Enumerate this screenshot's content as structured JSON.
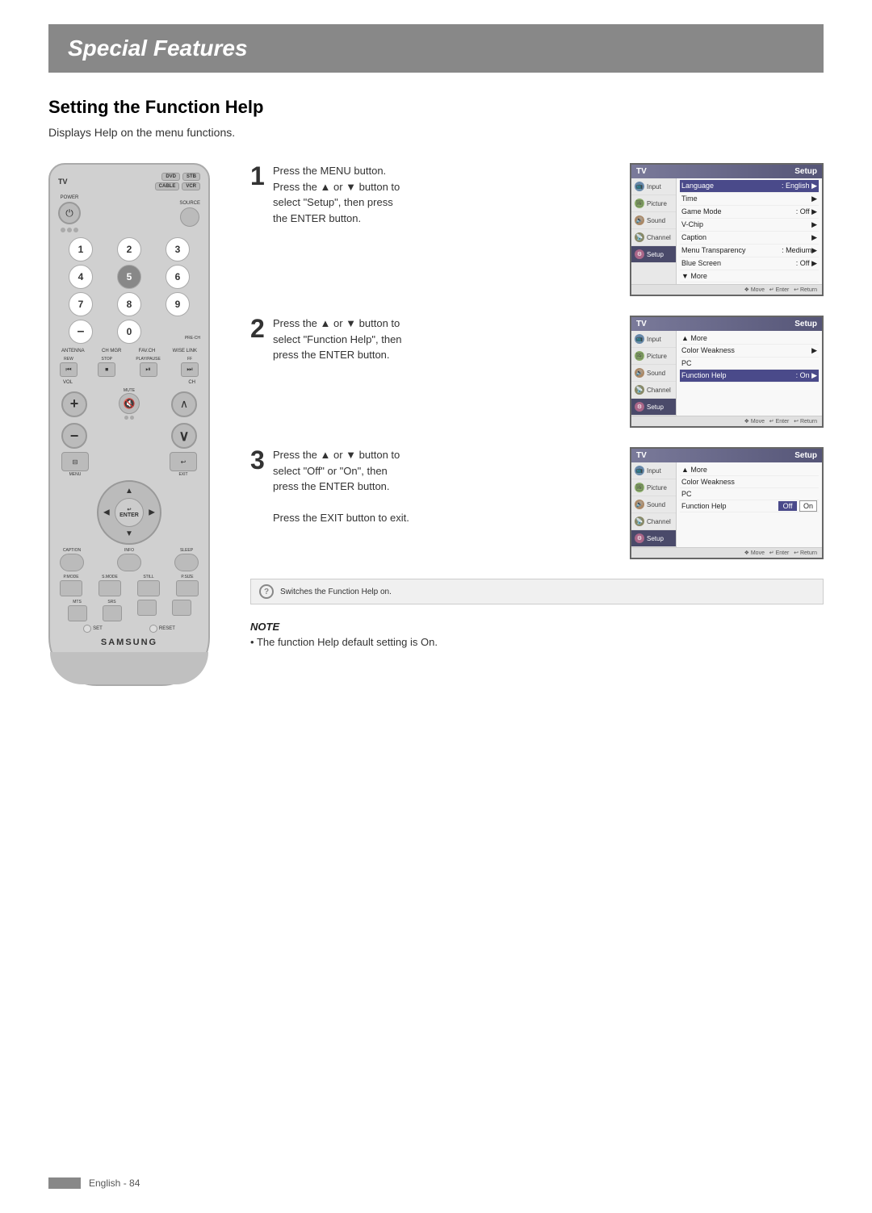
{
  "page": {
    "title": "Special Features",
    "section": "Setting the Function Help",
    "description": "Displays Help on the menu functions.",
    "footer": "English - 84"
  },
  "remote": {
    "tv_label": "TV",
    "dvd_label": "DVD",
    "stb_label": "STB",
    "cable_label": "CABLE",
    "vcr_label": "VCR",
    "power_label": "POWER",
    "source_label": "SOURCE",
    "numbers": [
      "1",
      "2",
      "3",
      "4",
      "5",
      "6",
      "7",
      "8",
      "9",
      "–",
      "0"
    ],
    "pre_ch": "PRE-CH",
    "antenna": "ANTENNA",
    "ch_mgr": "CH MGR",
    "fav_ch": "FAV.CH",
    "wise_link": "WISE LINK",
    "rew": "REW",
    "stop": "STOP",
    "play_pause": "PLAY/PAUSE",
    "ff": "FF",
    "vol": "VOL",
    "ch": "CH",
    "mute": "MUTE",
    "menu": "MENU",
    "exit": "EXIT",
    "enter": "ENTER",
    "caption": "CAPTION",
    "info": "INFO",
    "sleep": "SLEEP",
    "p_mode": "P.MODE",
    "s_mode": "S.MODE",
    "still": "STILL",
    "p_size": "P.SIZE",
    "mts": "MTS",
    "srs": "SRS",
    "set": "SET",
    "reset": "RESET",
    "samsung": "SAMSUNG"
  },
  "steps": [
    {
      "number": "1",
      "text_line1": "Press the MENU button.",
      "text_line2": "Press the ▲ or ▼ button to",
      "text_line3": "select \"Setup\", then press",
      "text_line4": "the ENTER button."
    },
    {
      "number": "2",
      "text_line1": "Press the ▲ or ▼ button to",
      "text_line2": "select \"Function Help\", then",
      "text_line3": "press the ENTER button."
    },
    {
      "number": "3",
      "text_line1": "Press the ▲ or ▼ button to",
      "text_line2": "select \"Off\" or \"On\", then",
      "text_line3": "press the ENTER button.",
      "text_line4": "",
      "text_line5": "Press the EXIT button to exit."
    }
  ],
  "menus": [
    {
      "header_left": "TV",
      "header_right": "Setup",
      "sidebar": [
        {
          "label": "Input",
          "icon": "input"
        },
        {
          "label": "Picture",
          "icon": "picture"
        },
        {
          "label": "Sound",
          "icon": "sound"
        },
        {
          "label": "Channel",
          "icon": "channel"
        },
        {
          "label": "Setup",
          "icon": "setup",
          "active": true
        }
      ],
      "rows": [
        {
          "label": "Language",
          "value": ": English",
          "arrow": "▶"
        },
        {
          "label": "Time",
          "value": "",
          "arrow": "▶"
        },
        {
          "label": "Game Mode",
          "value": ": Off",
          "arrow": "▶"
        },
        {
          "label": "V-Chip",
          "value": "",
          "arrow": "▶"
        },
        {
          "label": "Caption",
          "value": "",
          "arrow": "▶"
        },
        {
          "label": "Menu Transparency",
          "value": ": Medium",
          "arrow": "▶"
        },
        {
          "label": "Blue Screen",
          "value": ": Off",
          "arrow": "▶"
        },
        {
          "label": "▼ More",
          "value": "",
          "arrow": ""
        }
      ],
      "footer": "❖ Move  ↵ Enter  ↩ Return"
    },
    {
      "header_left": "TV",
      "header_right": "Setup",
      "sidebar": [
        {
          "label": "Input",
          "icon": "input"
        },
        {
          "label": "Picture",
          "icon": "picture"
        },
        {
          "label": "Sound",
          "icon": "sound"
        },
        {
          "label": "Channel",
          "icon": "channel"
        },
        {
          "label": "Setup",
          "icon": "setup",
          "active": true
        }
      ],
      "rows": [
        {
          "label": "▲ More",
          "value": "",
          "arrow": "",
          "sub": true
        },
        {
          "label": "Color Weakness",
          "value": "",
          "arrow": "▶"
        },
        {
          "label": "PC",
          "value": "",
          "arrow": ""
        },
        {
          "label": "Function Help",
          "value": ": On",
          "arrow": "▶",
          "highlighted": true
        }
      ],
      "footer": "❖ Move  ↵ Enter  ↩ Return"
    },
    {
      "header_left": "TV",
      "header_right": "Setup",
      "sidebar": [
        {
          "label": "Input",
          "icon": "input"
        },
        {
          "label": "Picture",
          "icon": "picture"
        },
        {
          "label": "Sound",
          "icon": "sound"
        },
        {
          "label": "Channel",
          "icon": "channel"
        },
        {
          "label": "Setup",
          "icon": "setup",
          "active": true
        }
      ],
      "rows": [
        {
          "label": "▲ More",
          "value": "",
          "arrow": "",
          "sub": true
        },
        {
          "label": "Color Weakness",
          "value": "",
          "arrow": ""
        },
        {
          "label": "PC",
          "value": "",
          "arrow": ""
        },
        {
          "label": "Function Help",
          "value": "",
          "arrow": ""
        }
      ],
      "offon": true,
      "footer": "❖ Move  ↵ Enter  ↩ Return"
    }
  ],
  "info_box": {
    "text": "Switches the Function Help on."
  },
  "note": {
    "title": "NOTE",
    "bullet": "The function Help default setting is On."
  }
}
